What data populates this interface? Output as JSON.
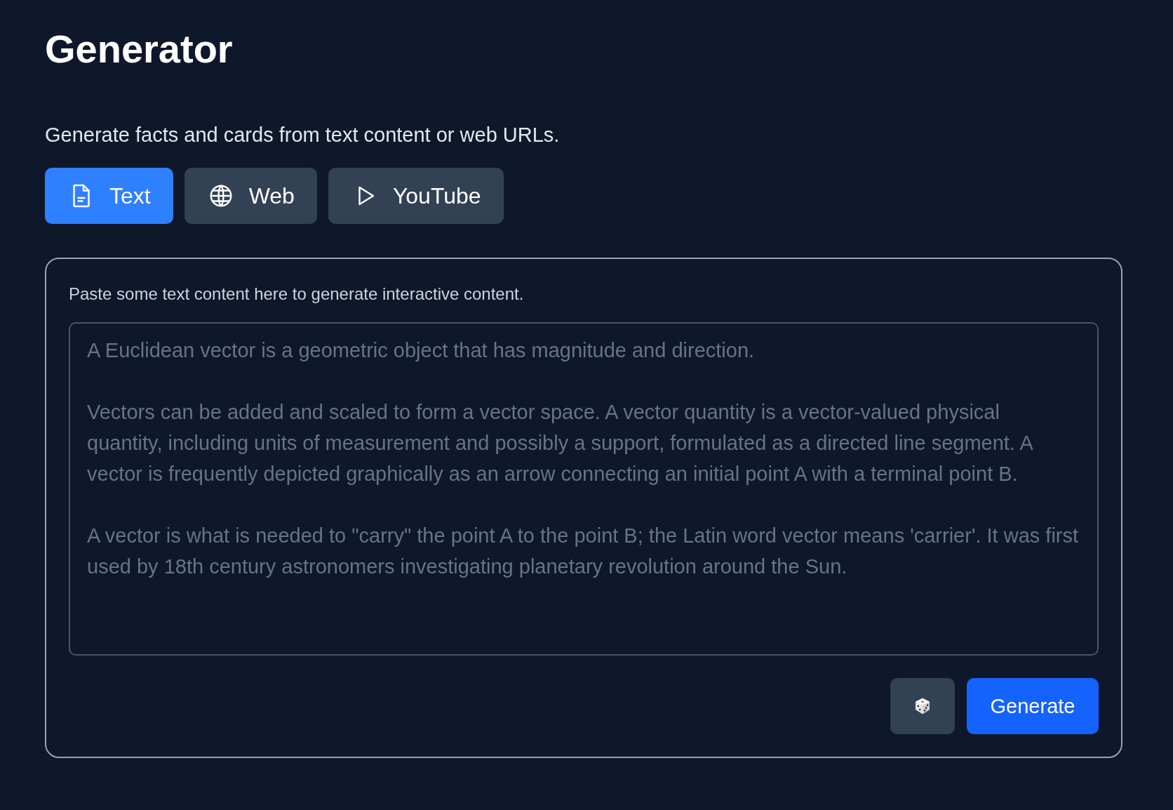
{
  "title": "Generator",
  "subtitle": "Generate facts and cards from text content or web URLs.",
  "tabs": [
    {
      "label": "Text",
      "kind": "document",
      "selected": true
    },
    {
      "label": "Web",
      "kind": "globe",
      "selected": false
    },
    {
      "label": "YouTube",
      "kind": "play",
      "selected": false
    }
  ],
  "panel": {
    "instruction": "Paste some text content here to generate interactive content.",
    "placeholder": "A Euclidean vector is a geometric object that has magnitude and direction.\n\nVectors can be added and scaled to form a vector space. A vector quantity is a vector-valued physical quantity, including units of measurement and possibly a support, formulated as a directed line segment. A vector is frequently depicted graphically as an arrow connecting an initial point A with a terminal point B.\n\nA vector is what is needed to \"carry\" the point A to the point B; the Latin word vector means 'carrier'. It was first used by 18th century astronomers investigating planetary revolution around the Sun.",
    "generate_button": "Generate"
  }
}
